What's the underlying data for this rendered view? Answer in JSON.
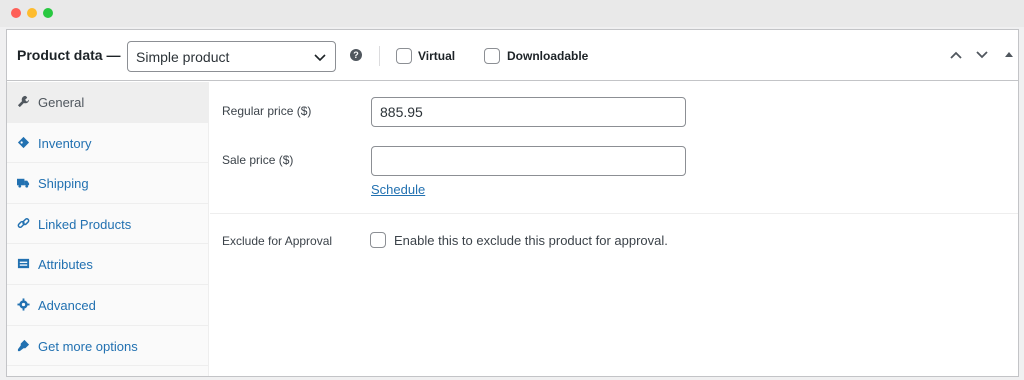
{
  "header": {
    "title": "Product data —",
    "product_type": "Simple product",
    "help_glyph": "?",
    "virtual_label": "Virtual",
    "downloadable_label": "Downloadable"
  },
  "tabs": [
    {
      "label": "General",
      "icon": "wrench-icon",
      "active": true
    },
    {
      "label": "Inventory",
      "icon": "tag-icon",
      "active": false
    },
    {
      "label": "Shipping",
      "icon": "truck-icon",
      "active": false
    },
    {
      "label": "Linked Products",
      "icon": "link-icon",
      "active": false
    },
    {
      "label": "Attributes",
      "icon": "list-icon",
      "active": false
    },
    {
      "label": "Advanced",
      "icon": "gear-icon",
      "active": false
    },
    {
      "label": "Get more options",
      "icon": "plugin-icon",
      "active": false
    }
  ],
  "general": {
    "regular_price_label": "Regular price ($)",
    "regular_price_value": "885.95",
    "sale_price_label": "Sale price ($)",
    "sale_price_value": "",
    "schedule_link": "Schedule",
    "exclude_label": "Exclude for Approval",
    "exclude_description": "Enable this to exclude this product for approval."
  },
  "colors": {
    "link": "#2271b1",
    "icon": "#2271b1",
    "active_tab_bg": "#eeeeee",
    "border": "#c3c4c7"
  }
}
